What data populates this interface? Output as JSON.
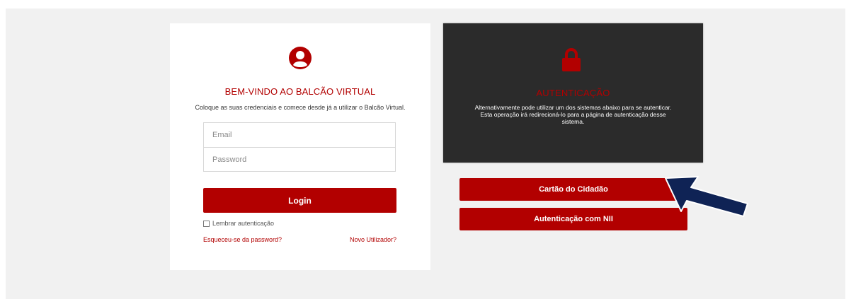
{
  "login": {
    "title": "BEM-VINDO AO BALCÃO VIRTUAL",
    "subtitle": "Coloque as suas credenciais e comece desde já a utilizar o Balcão Virtual.",
    "email_placeholder": "Email",
    "password_placeholder": "Password",
    "login_label": "Login",
    "remember_label": "Lembrar autenticação",
    "forgot_link": "Esqueceu-se da password?",
    "new_user_link": "Novo Utilizador?"
  },
  "auth": {
    "title": "AUTENTICAÇÃO",
    "description": "Alternativamente pode utilizar um dos sistemas abaixo para se autenticar. Esta operação irá redirecioná-lo para a página de autenticação desse sistema.",
    "cartao_label": "Cartão do Cidadão",
    "nii_label": "Autenticação com NII"
  },
  "icons": {
    "user": "user-circle-icon",
    "lock": "lock-icon",
    "arrow": "pointer-arrow"
  },
  "colors": {
    "accent": "#b20000",
    "dark_panel": "#2b2b2b",
    "background": "#f1f1f1",
    "arrow": "#0f2355"
  }
}
